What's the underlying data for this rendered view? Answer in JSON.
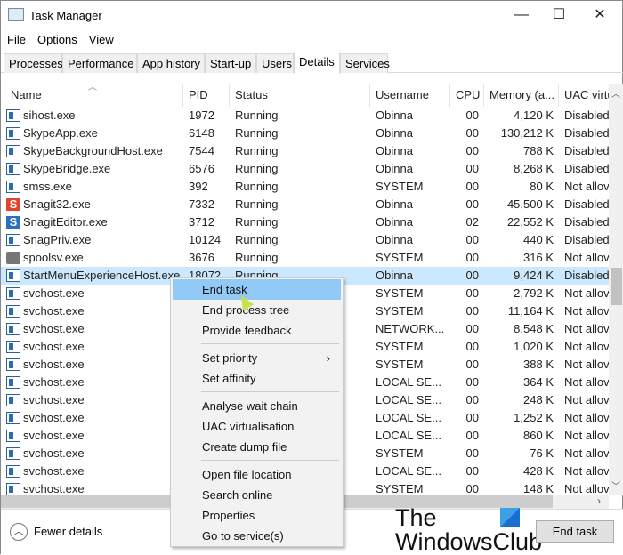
{
  "window": {
    "title": "Task Manager",
    "minimize": "—",
    "maximize": "☐",
    "close": "✕"
  },
  "menubar": [
    "File",
    "Options",
    "View"
  ],
  "tabs": [
    "Processes",
    "Performance",
    "App history",
    "Start-up",
    "Users",
    "Details",
    "Services"
  ],
  "active_tab": "Details",
  "columns": [
    "Name",
    "PID",
    "Status",
    "Username",
    "CPU",
    "Memory (a...",
    "UAC virtu"
  ],
  "rows": [
    {
      "icon": "app",
      "name": "sihost.exe",
      "pid": "1972",
      "status": "Running",
      "user": "Obinna",
      "cpu": "00",
      "mem": "4,120 K",
      "uac": "Disabled"
    },
    {
      "icon": "app",
      "name": "SkypeApp.exe",
      "pid": "6148",
      "status": "Running",
      "user": "Obinna",
      "cpu": "00",
      "mem": "130,212 K",
      "uac": "Disabled"
    },
    {
      "icon": "app",
      "name": "SkypeBackgroundHost.exe",
      "pid": "7544",
      "status": "Running",
      "user": "Obinna",
      "cpu": "00",
      "mem": "788 K",
      "uac": "Disabled"
    },
    {
      "icon": "app",
      "name": "SkypeBridge.exe",
      "pid": "6576",
      "status": "Running",
      "user": "Obinna",
      "cpu": "00",
      "mem": "8,268 K",
      "uac": "Disabled"
    },
    {
      "icon": "app",
      "name": "smss.exe",
      "pid": "392",
      "status": "Running",
      "user": "SYSTEM",
      "cpu": "00",
      "mem": "80 K",
      "uac": "Not allov"
    },
    {
      "icon": "snag",
      "name": "Snagit32.exe",
      "pid": "7332",
      "status": "Running",
      "user": "Obinna",
      "cpu": "00",
      "mem": "45,500 K",
      "uac": "Disabled"
    },
    {
      "icon": "snagb",
      "name": "SnagitEditor.exe",
      "pid": "3712",
      "status": "Running",
      "user": "Obinna",
      "cpu": "02",
      "mem": "22,552 K",
      "uac": "Disabled"
    },
    {
      "icon": "app",
      "name": "SnagPriv.exe",
      "pid": "10124",
      "status": "Running",
      "user": "Obinna",
      "cpu": "00",
      "mem": "440 K",
      "uac": "Disabled"
    },
    {
      "icon": "printer",
      "name": "spoolsv.exe",
      "pid": "3676",
      "status": "Running",
      "user": "SYSTEM",
      "cpu": "00",
      "mem": "316 K",
      "uac": "Not allov"
    },
    {
      "icon": "app",
      "name": "StartMenuExperienceHost.exe",
      "pid": "18072",
      "status": "Running",
      "user": "Obinna",
      "cpu": "00",
      "mem": "9,424 K",
      "uac": "Disabled",
      "selected": true
    },
    {
      "icon": "app",
      "name": "svchost.exe",
      "user": "SYSTEM",
      "cpu": "00",
      "mem": "2,792 K",
      "uac": "Not allov"
    },
    {
      "icon": "app",
      "name": "svchost.exe",
      "user": "SYSTEM",
      "cpu": "00",
      "mem": "11,164 K",
      "uac": "Not allov"
    },
    {
      "icon": "app",
      "name": "svchost.exe",
      "user": "NETWORK...",
      "cpu": "00",
      "mem": "8,548 K",
      "uac": "Not allov"
    },
    {
      "icon": "app",
      "name": "svchost.exe",
      "user": "SYSTEM",
      "cpu": "00",
      "mem": "1,020 K",
      "uac": "Not allov"
    },
    {
      "icon": "app",
      "name": "svchost.exe",
      "user": "SYSTEM",
      "cpu": "00",
      "mem": "388 K",
      "uac": "Not allov"
    },
    {
      "icon": "app",
      "name": "svchost.exe",
      "user": "LOCAL SE...",
      "cpu": "00",
      "mem": "364 K",
      "uac": "Not allov"
    },
    {
      "icon": "app",
      "name": "svchost.exe",
      "user": "LOCAL SE...",
      "cpu": "00",
      "mem": "248 K",
      "uac": "Not allov"
    },
    {
      "icon": "app",
      "name": "svchost.exe",
      "user": "LOCAL SE...",
      "cpu": "00",
      "mem": "1,252 K",
      "uac": "Not allov"
    },
    {
      "icon": "app",
      "name": "svchost.exe",
      "user": "LOCAL SE...",
      "cpu": "00",
      "mem": "860 K",
      "uac": "Not allov"
    },
    {
      "icon": "app",
      "name": "svchost.exe",
      "user": "SYSTEM",
      "cpu": "00",
      "mem": "76 K",
      "uac": "Not allov"
    },
    {
      "icon": "app",
      "name": "svchost.exe",
      "user": "LOCAL SE...",
      "cpu": "00",
      "mem": "428 K",
      "uac": "Not allov"
    },
    {
      "icon": "app",
      "name": "svchost.exe",
      "user": "SYSTEM",
      "cpu": "00",
      "mem": "148 K",
      "uac": "Not allov"
    }
  ],
  "context_menu": [
    [
      {
        "label": "End task",
        "highlighted": true
      },
      {
        "label": "End process tree"
      },
      {
        "label": "Provide feedback"
      }
    ],
    [
      {
        "label": "Set priority",
        "submenu": true
      },
      {
        "label": "Set affinity"
      }
    ],
    [
      {
        "label": "Analyse wait chain"
      },
      {
        "label": "UAC virtualisation"
      },
      {
        "label": "Create dump file"
      }
    ],
    [
      {
        "label": "Open file location"
      },
      {
        "label": "Search online"
      },
      {
        "label": "Properties"
      },
      {
        "label": "Go to service(s)"
      }
    ]
  ],
  "footer": {
    "fewer_details": "Fewer details",
    "end_task": "End task"
  },
  "watermark": {
    "line1": "The",
    "line2": "WindowsClub"
  }
}
